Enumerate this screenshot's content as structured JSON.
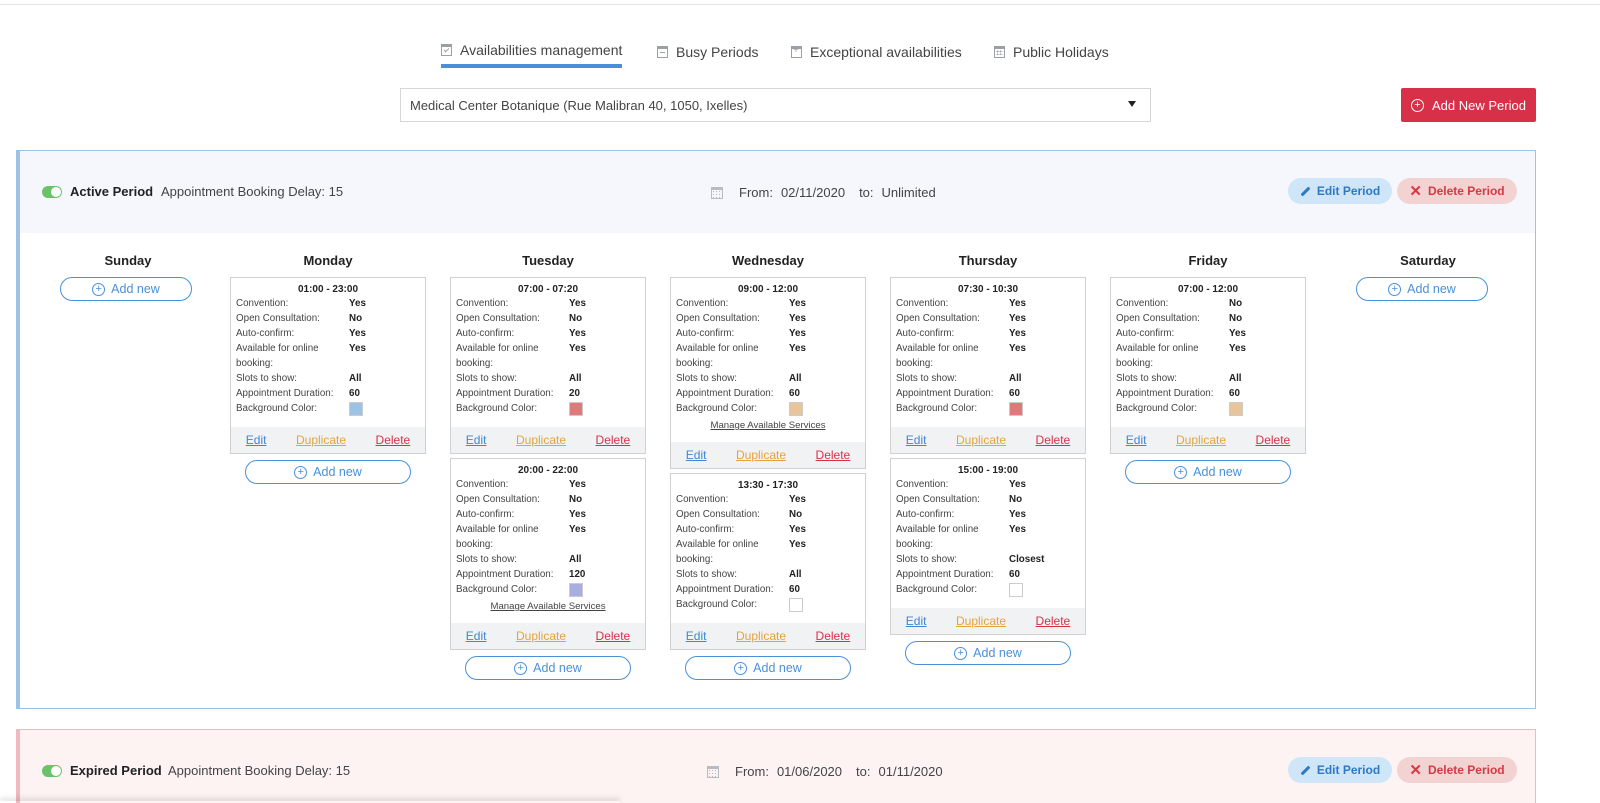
{
  "tabs": [
    {
      "label": "Availabilities management",
      "icon": "calendar-check-icon",
      "active": true
    },
    {
      "label": "Busy Periods",
      "icon": "calendar-minus-icon",
      "active": false
    },
    {
      "label": "Exceptional availabilities",
      "icon": "calendar-plus-icon",
      "active": false
    },
    {
      "label": "Public Holidays",
      "icon": "calendar-grid-icon",
      "active": false
    }
  ],
  "location_select": {
    "value": "Medical Center Botanique (Rue Malibran 40, 1050, Ixelles)"
  },
  "add_new_period": {
    "label": "Add New Period"
  },
  "colors": {
    "accent": "#4a90d9",
    "danger": "#d9304a",
    "toggle": "#6cc26a",
    "duplicate": "#e5a33a"
  },
  "common": {
    "add_new": "Add new",
    "edit": "Edit",
    "duplicate": "Duplicate",
    "delete": "Delete",
    "edit_period": "Edit Period",
    "delete_period": "Delete Period",
    "from": "From:",
    "to": "to:",
    "manage_services": "Manage Available Services",
    "labels": {
      "convention": "Convention:",
      "open_consultation": "Open Consultation:",
      "auto_confirm": "Auto-confirm:",
      "online_booking_1": "Available for online",
      "online_booking_2": "booking:",
      "slots": "Slots to show:",
      "duration": "Appointment Duration:",
      "bg_color": "Background Color:"
    }
  },
  "active_period": {
    "status": "Active Period",
    "delay": "Appointment Booking Delay: 15",
    "from": "02/11/2020",
    "to": "Unlimited"
  },
  "expired_period": {
    "status": "Expired Period",
    "delay": "Appointment Booking Delay: 15",
    "from": "01/06/2020",
    "to": "01/11/2020"
  },
  "days": [
    {
      "name": "Sunday",
      "slots": []
    },
    {
      "name": "Monday",
      "slots": [
        {
          "time": "01:00 - 23:00",
          "convention": "Yes",
          "open_consultation": "No",
          "auto_confirm": "Yes",
          "online": "Yes",
          "slots": "All",
          "duration": "60",
          "color": "#9cc3e4",
          "manage": false
        }
      ]
    },
    {
      "name": "Tuesday",
      "slots": [
        {
          "time": "07:00 - 07:20",
          "convention": "Yes",
          "open_consultation": "No",
          "auto_confirm": "Yes",
          "online": "Yes",
          "slots": "All",
          "duration": "20",
          "color": "#e07a7a",
          "manage": false
        },
        {
          "time": "20:00 - 22:00",
          "convention": "Yes",
          "open_consultation": "No",
          "auto_confirm": "Yes",
          "online": "Yes",
          "slots": "All",
          "duration": "120",
          "color": "#a9aee0",
          "manage": true
        }
      ]
    },
    {
      "name": "Wednesday",
      "slots": [
        {
          "time": "09:00 - 12:00",
          "convention": "Yes",
          "open_consultation": "Yes",
          "auto_confirm": "Yes",
          "online": "Yes",
          "slots": "All",
          "duration": "60",
          "color": "#e8c49a",
          "manage": true
        },
        {
          "time": "13:30 - 17:30",
          "convention": "Yes",
          "open_consultation": "No",
          "auto_confirm": "Yes",
          "online": "Yes",
          "slots": "All",
          "duration": "60",
          "color": "#ffffff",
          "manage": false
        }
      ]
    },
    {
      "name": "Thursday",
      "slots": [
        {
          "time": "07:30 - 10:30",
          "convention": "Yes",
          "open_consultation": "Yes",
          "auto_confirm": "Yes",
          "online": "Yes",
          "slots": "All",
          "duration": "60",
          "color": "#e07a7a",
          "manage": false
        },
        {
          "time": "15:00 - 19:00",
          "convention": "Yes",
          "open_consultation": "No",
          "auto_confirm": "Yes",
          "online": "Yes",
          "slots": "Closest",
          "duration": "60",
          "color": "#ffffff",
          "manage": false
        }
      ]
    },
    {
      "name": "Friday",
      "slots": [
        {
          "time": "07:00 - 12:00",
          "convention": "No",
          "open_consultation": "No",
          "auto_confirm": "Yes",
          "online": "Yes",
          "slots": "All",
          "duration": "60",
          "color": "#e8c49a",
          "manage": false
        }
      ]
    },
    {
      "name": "Saturday",
      "slots": []
    }
  ]
}
